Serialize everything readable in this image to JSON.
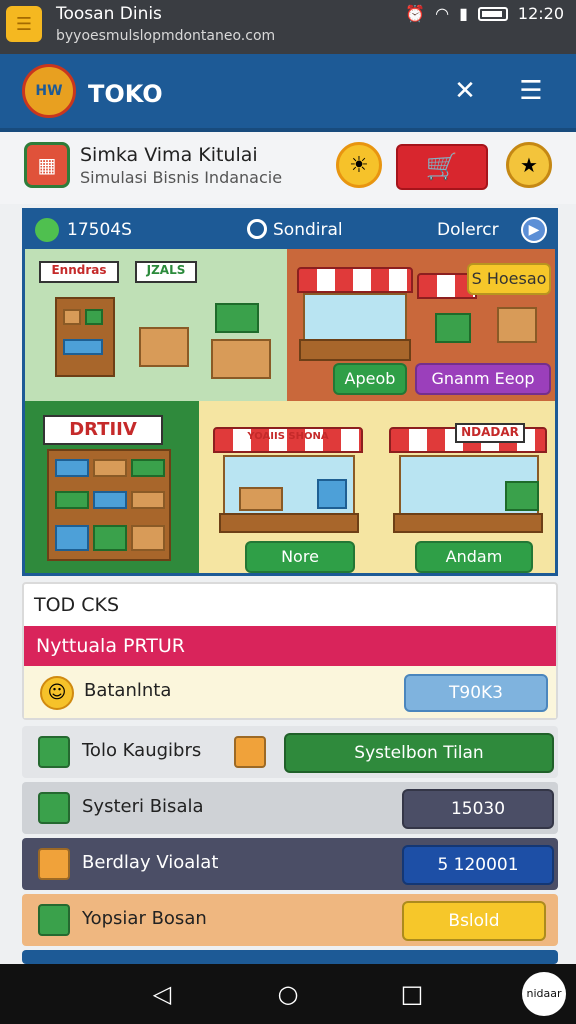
{
  "status": {
    "title": "Toosan Dinis",
    "url": "byyoesmulslopmdontaneo.com",
    "time": "12:20"
  },
  "appbar": {
    "title": "TOKO",
    "logo_text": "HW"
  },
  "intro": {
    "title": "Simka Vima Kitulai",
    "subtitle": "Simulasi Bisnis Indanacie"
  },
  "board": {
    "value": "17504S",
    "mode": "Sondiral",
    "right": "Dolercr",
    "tiles": {
      "t1": {
        "sign1": "Enndras",
        "sign2": "JZALS"
      },
      "t2": {
        "tag": "S Hoesao",
        "btn1": "Apeob",
        "btn2": "Gnanm Eeop"
      },
      "t3": {
        "sign": "DRTIIV"
      },
      "t4": {
        "sign1": "YOAIIS SHONA",
        "sign2": "NDADAR",
        "btn1": "Nore",
        "btn2": "Andam"
      }
    }
  },
  "panel": {
    "title": "TOD CKS",
    "banner": "Nyttuala PRTUR",
    "row_label": "Batanlnta",
    "row_button": "T90K3"
  },
  "rows": [
    {
      "label": "Tolo Kaugibrs",
      "button": "Systelbon Tilan"
    },
    {
      "label": "Systeri Bisala",
      "button": "15030"
    },
    {
      "label": "Berdlay Vioalat",
      "button": "5 120001"
    },
    {
      "label": "Yopsiar Bosan",
      "button": "Bslold"
    }
  ],
  "nav": {
    "corner": "nidaar"
  }
}
